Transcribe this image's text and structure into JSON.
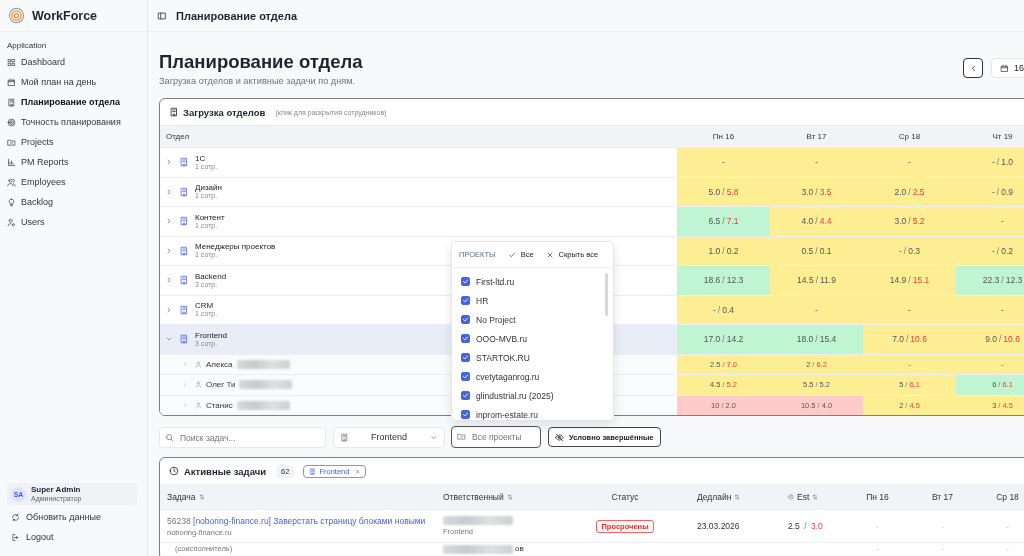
{
  "app": {
    "name": "WorkForce"
  },
  "sidebar": {
    "section": "Application",
    "items": [
      {
        "label": "Dashboard",
        "selected": false
      },
      {
        "label": "Мой план на день",
        "selected": false
      },
      {
        "label": "Планирование отдела",
        "selected": true
      },
      {
        "label": "Точность планирования",
        "selected": false
      },
      {
        "label": "Projects",
        "selected": false
      },
      {
        "label": "PM Reports",
        "selected": false
      },
      {
        "label": "Employees",
        "selected": false
      },
      {
        "label": "Backlog",
        "selected": false
      },
      {
        "label": "Users",
        "selected": false
      }
    ],
    "user": {
      "initials": "SA",
      "name": "Super Admin",
      "role": "Администратор"
    },
    "actions": [
      "Обновить данные",
      "Logout"
    ]
  },
  "header": {
    "title": "Планирование отдела"
  },
  "page": {
    "title": "Планирование отдела",
    "subtitle": "Загрузка отделов и активные задачи по дням.",
    "date_button": "16"
  },
  "load_panel": {
    "title": "Загрузка отделов",
    "hint": "(клик для раскрытия сотрудников)",
    "columns": {
      "department": "Отдел",
      "days": [
        "Пн 16",
        "Вт 17",
        "Ср 18",
        "Чт 19"
      ]
    },
    "rows": [
      {
        "name": "1C",
        "count": "1 сотр.",
        "expanded": false,
        "cells": [
          {
            "plan": "-",
            "color": "#fdee93"
          },
          {
            "plan": "-",
            "color": "#fdee93"
          },
          {
            "plan": "-",
            "color": "#fdee93"
          },
          {
            "plan": "-",
            "sep": "/",
            "fact": "1.0",
            "over": false,
            "color": "#fdee93"
          }
        ]
      },
      {
        "name": "Дизайн",
        "count": "1 сотр.",
        "expanded": false,
        "cells": [
          {
            "plan": "5.0",
            "sep": "/",
            "fact": "5.8",
            "over": true,
            "color": "#fdee93"
          },
          {
            "plan": "3.0",
            "sep": "/",
            "fact": "3.5",
            "over": true,
            "color": "#fdee93"
          },
          {
            "plan": "2.0",
            "sep": "/",
            "fact": "2.5",
            "over": true,
            "color": "#fdee93"
          },
          {
            "plan": "-",
            "sep": "/",
            "fact": "0.9",
            "over": false,
            "color": "#fdee93"
          }
        ]
      },
      {
        "name": "Контент",
        "count": "1 сотр.",
        "expanded": false,
        "cells": [
          {
            "plan": "6.5",
            "sep": "/",
            "fact": "7.1",
            "over": true,
            "color": "#bff5d2"
          },
          {
            "plan": "4.0",
            "sep": "/",
            "fact": "4.4",
            "over": true,
            "color": "#fdee93"
          },
          {
            "plan": "3.0",
            "sep": "/",
            "fact": "5.2",
            "over": true,
            "color": "#fdee93"
          },
          {
            "plan": "-",
            "color": "#fdee93"
          }
        ]
      },
      {
        "name": "Менеджеры проектов",
        "count": "1 сотр.",
        "expanded": false,
        "cells": [
          {
            "plan": "1.0",
            "sep": "/",
            "fact": "0.2",
            "over": false,
            "color": "#fdee93"
          },
          {
            "plan": "0.5",
            "sep": "/",
            "fact": "0.1",
            "over": false,
            "color": "#fdee93"
          },
          {
            "plan": "-",
            "sep": "/",
            "fact": "0.3",
            "over": false,
            "color": "#fdee93"
          },
          {
            "plan": "-",
            "sep": "/",
            "fact": "0.2",
            "over": false,
            "color": "#fdee93"
          }
        ]
      },
      {
        "name": "Backend",
        "count": "3 сотр.",
        "expanded": false,
        "cells": [
          {
            "plan": "18.6",
            "sep": "/",
            "fact": "12.3",
            "over": false,
            "color": "#bff5d2"
          },
          {
            "plan": "14.5",
            "sep": "/",
            "fact": "11.9",
            "over": false,
            "color": "#fdee93"
          },
          {
            "plan": "14.9",
            "sep": "/",
            "fact": "15.1",
            "over": true,
            "color": "#fdee93"
          },
          {
            "plan": "22.3",
            "sep": "/",
            "fact": "12.3",
            "over": false,
            "color": "#bff5d2"
          }
        ]
      },
      {
        "name": "CRM",
        "count": "1 сотр.",
        "expanded": false,
        "cells": [
          {
            "plan": "-",
            "sep": "/",
            "fact": "0.4",
            "over": false,
            "color": "#fdee93"
          },
          {
            "plan": "-",
            "color": "#fdee93"
          },
          {
            "plan": "-",
            "color": "#fdee93"
          },
          {
            "plan": "-",
            "color": "#fdee93"
          }
        ]
      },
      {
        "name": "Frontend",
        "count": "3 сотр.",
        "expanded": true,
        "cells": [
          {
            "plan": "17.0",
            "sep": "/",
            "fact": "14.2",
            "over": false,
            "color": "#bff5d2"
          },
          {
            "plan": "18.0",
            "sep": "/",
            "fact": "15.4",
            "over": false,
            "color": "#bff5d2"
          },
          {
            "plan": "7.0",
            "sep": "/",
            "fact": "10.6",
            "over": true,
            "color": "#fdee93"
          },
          {
            "plan": "9.0",
            "sep": "/",
            "fact": "10.6",
            "over": true,
            "color": "#fdee93"
          }
        ],
        "children": [
          {
            "name": "Алекса",
            "cells": [
              {
                "plan": "2.5",
                "sep": "/",
                "fact": "7.0",
                "over": true,
                "color": "#fdee93"
              },
              {
                "plan": "2",
                "sep": "/",
                "fact": "6.2",
                "over": true,
                "color": "#fdee93"
              },
              {
                "plan": "-",
                "color": "#fdee93"
              },
              {
                "plan": "-",
                "color": "#fdee93"
              }
            ]
          },
          {
            "name": "Олег Ти",
            "cells": [
              {
                "plan": "4.5",
                "sep": "/",
                "fact": "5.2",
                "over": true,
                "color": "#fdee93"
              },
              {
                "plan": "5.5",
                "sep": "/",
                "fact": "5.2",
                "over": false,
                "color": "#fdee93"
              },
              {
                "plan": "5",
                "sep": "/",
                "fact": "6.1",
                "over": true,
                "color": "#fdee93"
              },
              {
                "plan": "6",
                "sep": "/",
                "fact": "6.1",
                "over": true,
                "color": "#bff5d2"
              }
            ]
          },
          {
            "name": "Станис",
            "cells": [
              {
                "plan": "10",
                "sep": "/",
                "fact": "2.0",
                "over": false,
                "color": "#fecaca"
              },
              {
                "plan": "10.5",
                "sep": "/",
                "fact": "4.0",
                "over": false,
                "color": "#fecaca"
              },
              {
                "plan": "2",
                "sep": "/",
                "fact": "4.5",
                "over": true,
                "color": "#fdee93"
              },
              {
                "plan": "3",
                "sep": "/",
                "fact": "4.5",
                "over": true,
                "color": "#fdee93"
              }
            ]
          }
        ]
      }
    ]
  },
  "projects_menu": {
    "title": "ПРОЕКТЫ",
    "select_all": "Все",
    "hide_all": "Скрыть все",
    "items": [
      {
        "label": "First-ltd.ru",
        "checked": true
      },
      {
        "label": "HR",
        "checked": true
      },
      {
        "label": "No Project",
        "checked": true
      },
      {
        "label": "OOO-MVB.ru",
        "checked": true
      },
      {
        "label": "STARTOK.RU",
        "checked": true
      },
      {
        "label": "cvetytaganrog.ru",
        "checked": true
      },
      {
        "label": "glindustrial.ru (2025)",
        "checked": true
      },
      {
        "label": "inprom-estate.ru",
        "checked": true
      }
    ]
  },
  "filters": {
    "search": {
      "placeholder": "Поиск задач..."
    },
    "department": "Frontend",
    "projects": {
      "placeholder": "Все проекты"
    },
    "toggle": "Условно завершённые"
  },
  "tasks": {
    "title": "Активные задачи",
    "count": "62",
    "chip": {
      "label": "Frontend",
      "remove": "×"
    },
    "columns": [
      {
        "label": "Задача",
        "sortable": true,
        "icon": false
      },
      {
        "label": "Ответственный",
        "sortable": true,
        "icon": false
      },
      {
        "label": "Статус",
        "sortable": false,
        "icon": false
      },
      {
        "label": "Дедлайн",
        "sortable": true,
        "icon": false
      },
      {
        "label": "Est",
        "sortable": true,
        "icon": true
      },
      {
        "label": "Пн 16",
        "sortable": false,
        "icon": false
      },
      {
        "label": "Вт 17",
        "sortable": false,
        "icon": false
      },
      {
        "label": "Ср 18",
        "sortable": false,
        "icon": false
      }
    ],
    "rows": [
      {
        "id": "56238",
        "title": "[noboring-finance.ru] Заверстать страницу блоками новыми",
        "project": "noboring-finance.ru",
        "assignee_dept": "Frontend",
        "status": "Просрочены",
        "deadline": "23.03.2026",
        "est_plan": "2.5",
        "est_sep": "/",
        "est_fact": "3.0",
        "est_over": true,
        "days": [
          "-",
          "-",
          "-"
        ]
      },
      {
        "project": "(соисполнитель)",
        "assignee_tail": "ов",
        "days": [
          "-",
          "-",
          "-"
        ]
      }
    ]
  }
}
